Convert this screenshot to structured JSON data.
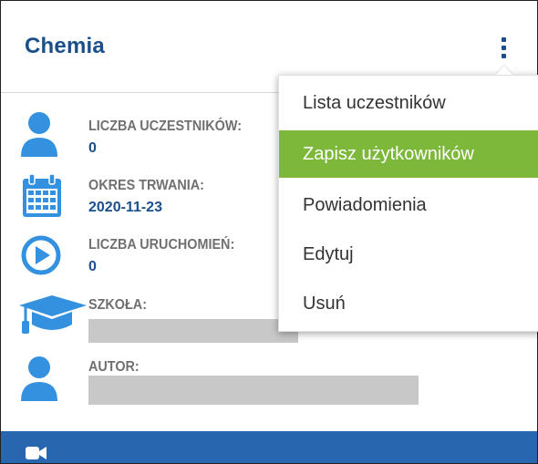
{
  "card": {
    "title": "Chemia",
    "menu_icon": "vertical-ellipsis-icon"
  },
  "info": [
    {
      "label": "LICZBA UCZESTNIKÓW:",
      "value": "0",
      "icon": "user-icon"
    },
    {
      "label": "OKRES TRWANIA:",
      "value": "2020-11-23",
      "icon": "calendar-icon"
    },
    {
      "label": "LICZBA URUCHOMIEŃ:",
      "value": "0",
      "icon": "play-circle-icon"
    },
    {
      "label": "SZKOŁA:",
      "value": "",
      "icon": "graduation-cap-icon"
    },
    {
      "label": "AUTOR:",
      "value": "",
      "icon": "user-icon"
    }
  ],
  "menu": {
    "items": [
      {
        "label": "Lista uczestników"
      },
      {
        "label": "Zapisz użytkowników",
        "active": true
      },
      {
        "label": "Powiadomienia"
      },
      {
        "label": "Edytuj"
      },
      {
        "label": "Usuń"
      }
    ]
  },
  "footer": {
    "icon": "video-camera-icon"
  },
  "colors": {
    "title": "#1a4f8a",
    "icon": "#3391e0",
    "menu_active": "#7db83a",
    "footer": "#2866b0",
    "label": "#707070"
  }
}
